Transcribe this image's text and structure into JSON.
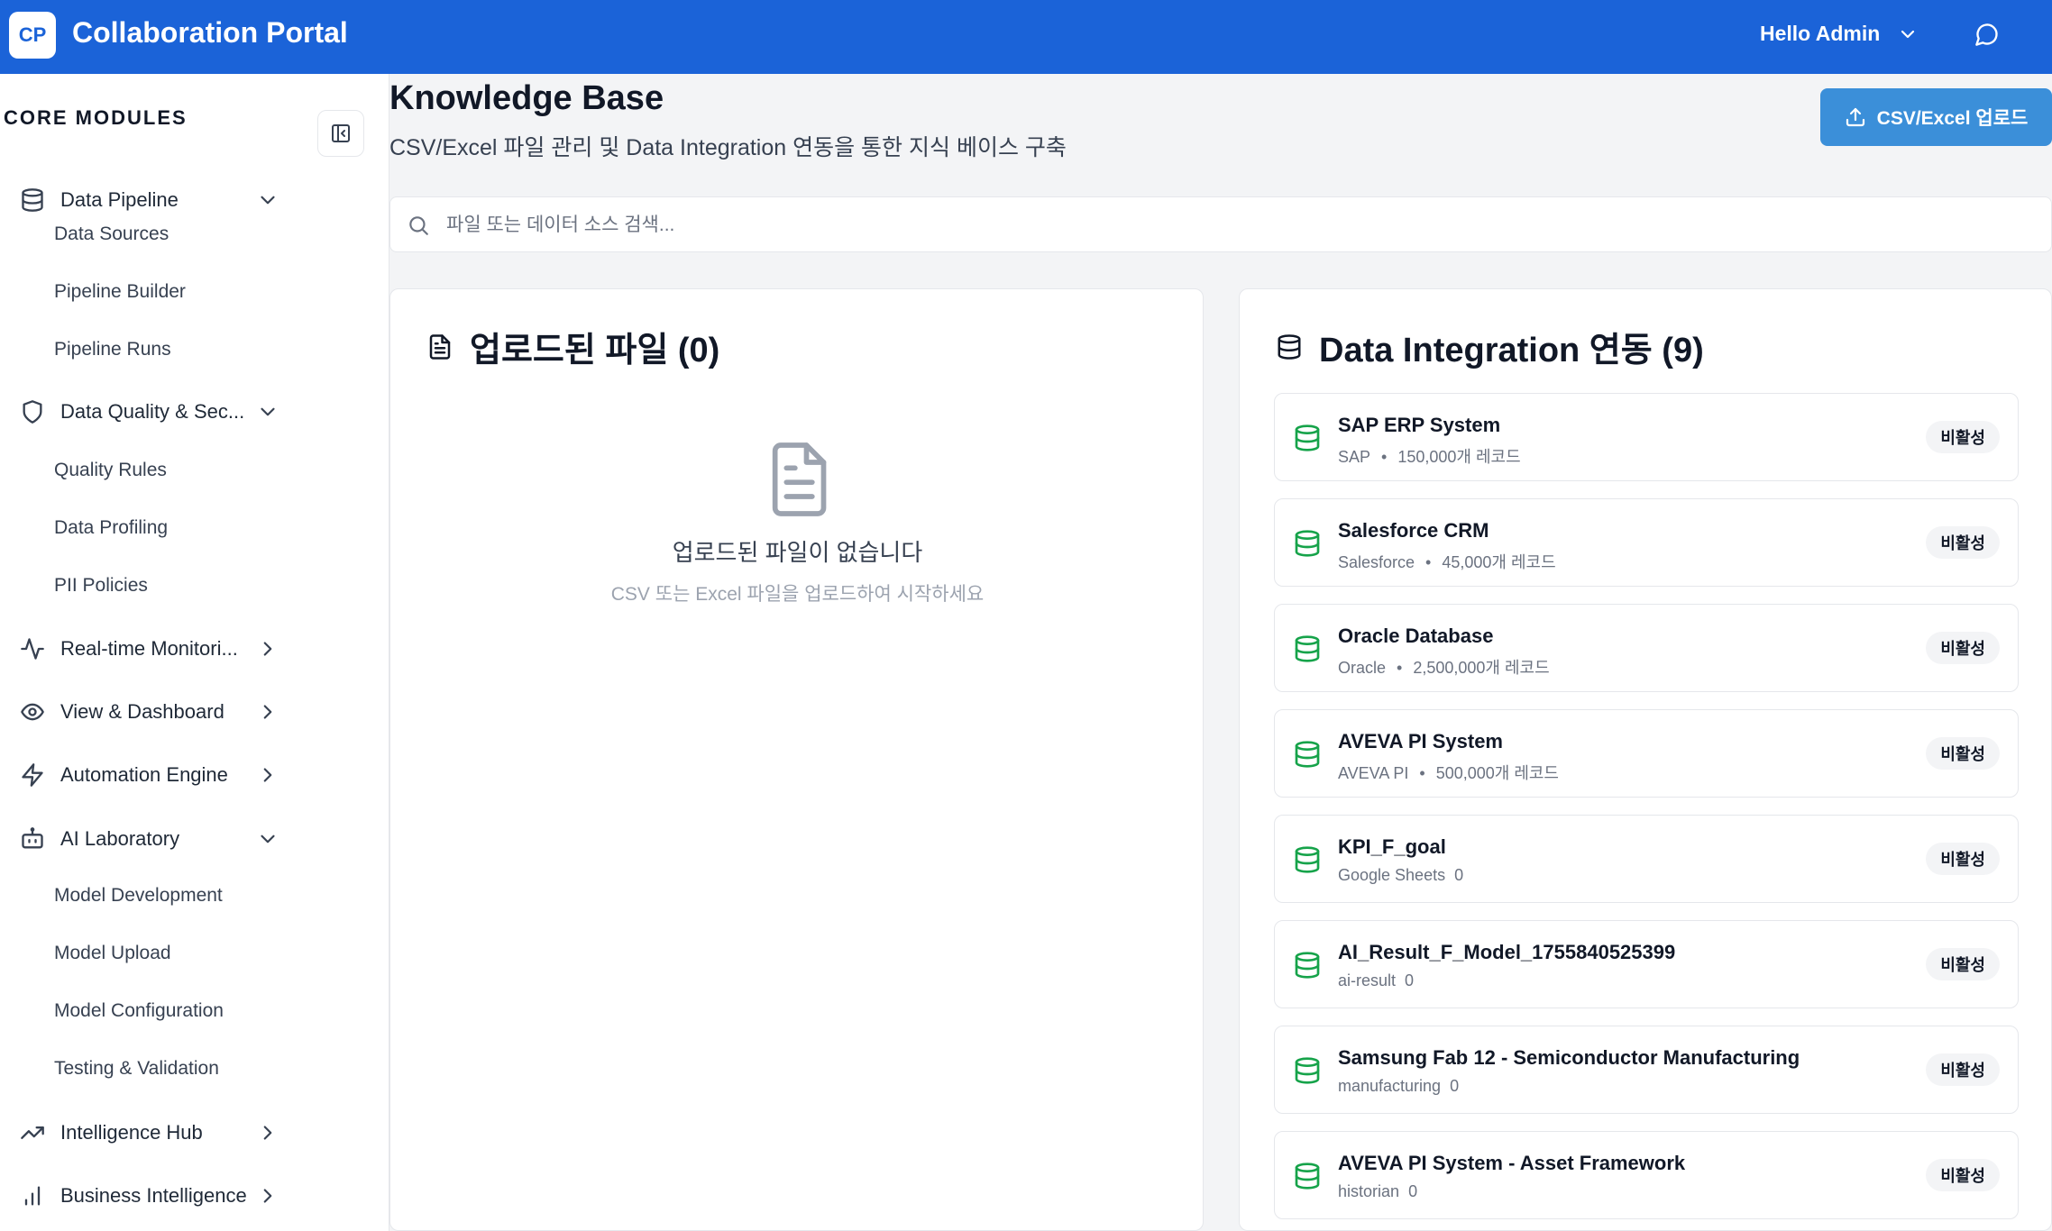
{
  "header": {
    "logo_text": "CP",
    "app_title": "Collaboration Portal",
    "user_greeting": "Hello Admin"
  },
  "sidebar": {
    "heading": "CORE MODULES",
    "groups": [
      {
        "label": "Data Pipeline",
        "icon": "database-icon",
        "expanded": true,
        "children": [
          "Data Sources",
          "Pipeline Builder",
          "Pipeline Runs"
        ]
      },
      {
        "label": "Data Quality & Sec...",
        "icon": "shield-icon",
        "expanded": true,
        "children": [
          "Quality Rules",
          "Data Profiling",
          "PII Policies"
        ]
      },
      {
        "label": "Real-time Monitori...",
        "icon": "activity-icon",
        "expanded": false,
        "children": []
      },
      {
        "label": "View & Dashboard",
        "icon": "eye-icon",
        "expanded": false,
        "children": []
      },
      {
        "label": "Automation Engine",
        "icon": "zap-icon",
        "expanded": false,
        "children": []
      },
      {
        "label": "AI Laboratory",
        "icon": "bot-icon",
        "expanded": true,
        "children": [
          "Model Development",
          "Model Upload",
          "Model Configuration",
          "Testing & Validation"
        ]
      },
      {
        "label": "Intelligence Hub",
        "icon": "trending-up-icon",
        "expanded": false,
        "children": []
      },
      {
        "label": "Business Intelligence",
        "icon": "bar-chart-icon",
        "expanded": false,
        "children": []
      }
    ]
  },
  "main": {
    "title": "Knowledge Base",
    "subtitle": "CSV/Excel 파일 관리 및 Data Integration 연동을 통한 지식 베이스 구축",
    "upload_button": "CSV/Excel 업로드",
    "search": {
      "placeholder": "파일 또는 데이터 소스 검색...",
      "value": ""
    },
    "files_panel": {
      "title": "업로드된 파일 (0)",
      "empty_title": "업로드된 파일이 없습니다",
      "empty_sub": "CSV 또는 Excel 파일을 업로드하여 시작하세요"
    },
    "integration_panel": {
      "title": "Data Integration 연동 (9)",
      "items": [
        {
          "name": "SAP ERP System",
          "source": "SAP",
          "records": "150,000개 레코드",
          "status": "비활성"
        },
        {
          "name": "Salesforce CRM",
          "source": "Salesforce",
          "records": "45,000개 레코드",
          "status": "비활성"
        },
        {
          "name": "Oracle Database",
          "source": "Oracle",
          "records": "2,500,000개 레코드",
          "status": "비활성"
        },
        {
          "name": "AVEVA PI System",
          "source": "AVEVA PI",
          "records": "500,000개 레코드",
          "status": "비활성"
        },
        {
          "name": "KPI_F_goal",
          "source": "Google Sheets",
          "records": "0",
          "status": "비활성"
        },
        {
          "name": "AI_Result_F_Model_1755840525399",
          "source": "ai-result",
          "records": "0",
          "status": "비활성"
        },
        {
          "name": "Samsung Fab 12 - Semiconductor Manufacturing",
          "source": "manufacturing",
          "records": "0",
          "status": "비활성"
        },
        {
          "name": "AVEVA PI System - Asset Framework",
          "source": "historian",
          "records": "0",
          "status": "비활성"
        }
      ]
    }
  },
  "colors": {
    "header_bg": "#1b63d8",
    "upload_btn": "#3b8fd9",
    "db_icon_green": "#16a34a"
  }
}
